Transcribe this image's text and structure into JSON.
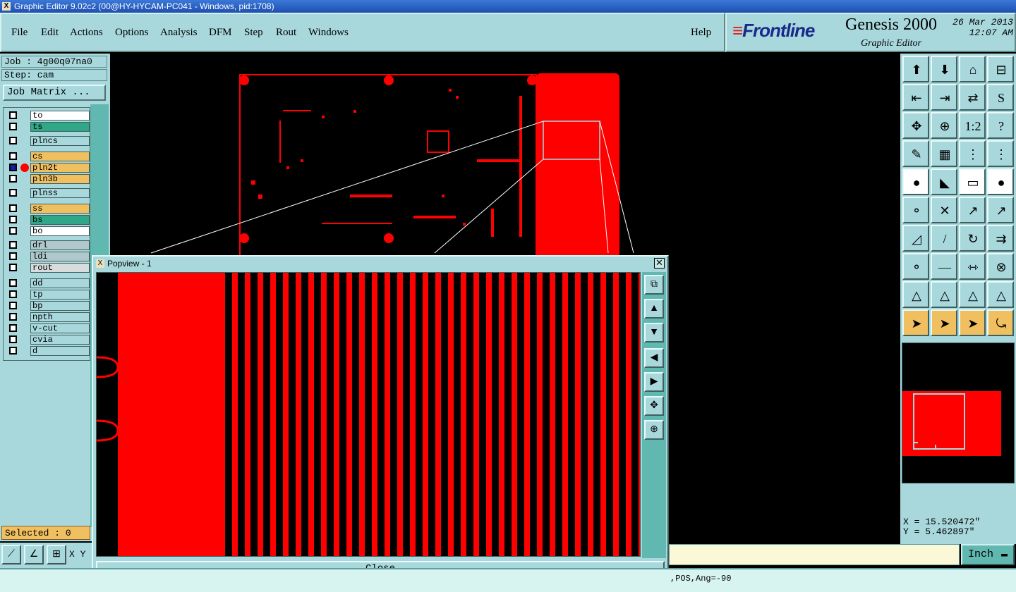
{
  "window": {
    "title": "Graphic Editor 9.02c2 (00@HY-HYCAM-PC041 - Windows, pid:1708)"
  },
  "menu": {
    "items": [
      "File",
      "Edit",
      "Actions",
      "Options",
      "Analysis",
      "DFM",
      "Step",
      "Rout",
      "Windows"
    ],
    "help": "Help"
  },
  "brand": {
    "logo": "Frontline",
    "product": "Genesis 2000",
    "subtitle": "Graphic Editor",
    "date": "26 Mar 2013",
    "time": "12:07 AM"
  },
  "job": {
    "job_label": "Job : 4g00q07na0",
    "step_label": "Step: cam",
    "matrix_button": "Job Matrix ..."
  },
  "layers": [
    {
      "name": "to",
      "color": "#ffffff"
    },
    {
      "name": "ts",
      "color": "#30a888"
    },
    {
      "name": "plncs",
      "color": "#a8d8dc"
    },
    {
      "name": "cs",
      "color": "#f0c060"
    },
    {
      "name": "pln2t",
      "color": "#f0c060",
      "active": true
    },
    {
      "name": "pln3b",
      "color": "#f0c060"
    },
    {
      "name": "plnss",
      "color": "#a8d8dc"
    },
    {
      "name": "ss",
      "color": "#f0c060"
    },
    {
      "name": "bs",
      "color": "#30a888"
    },
    {
      "name": "bo",
      "color": "#ffffff"
    },
    {
      "name": "drl",
      "color": "#b0c8cc"
    },
    {
      "name": "ldi",
      "color": "#b0c8cc"
    },
    {
      "name": "rout",
      "color": "#d8dcdc"
    },
    {
      "name": "dd",
      "color": "#a8d8dc"
    },
    {
      "name": "tp",
      "color": "#a8d8dc"
    },
    {
      "name": "bp",
      "color": "#a8d8dc"
    },
    {
      "name": "npth",
      "color": "#a8d8dc"
    },
    {
      "name": "v-cut",
      "color": "#a8d8dc"
    },
    {
      "name": "cvia",
      "color": "#a8d8dc"
    },
    {
      "name": "d",
      "color": "#a8d8dc"
    }
  ],
  "selected": "Selected : 0",
  "xy_label": "X Y",
  "popview": {
    "title": "Popview - 1",
    "close_button": "Close"
  },
  "coords": {
    "x": "X = 15.520472\"",
    "y": "Y = 5.462897\""
  },
  "units": "Inch",
  "status": {
    "message": ",POS,Ang=-90"
  },
  "colors": {
    "accent_red": "#ff0000",
    "panel": "#a8d8dc",
    "teal": "#60b8b0",
    "highlight": "#f0c060"
  }
}
